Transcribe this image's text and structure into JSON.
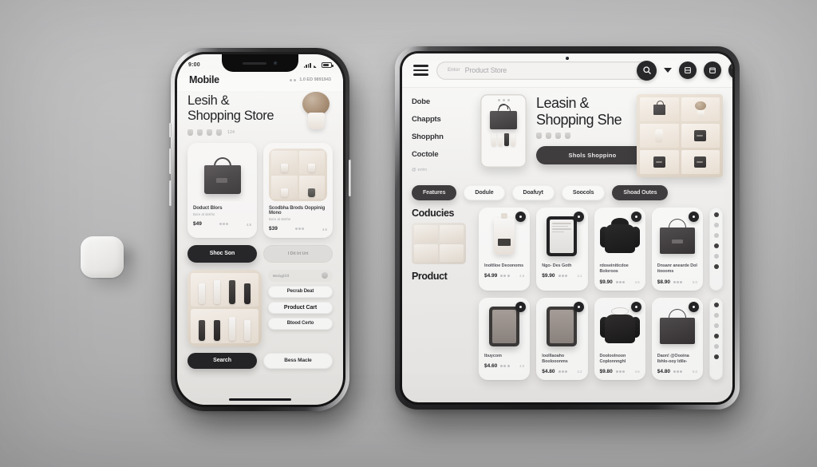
{
  "scene": {
    "background_color": "#bcbcbd",
    "objects": [
      {
        "name": "white-speaker-puck",
        "color": "#f5f3f0"
      }
    ]
  },
  "phone": {
    "frame_color": "#1d1d1f",
    "status_bar": {
      "time": "9:00",
      "icons": [
        "signal-icon",
        "wifi-icon",
        "battery-icon"
      ]
    },
    "app_bar": {
      "brand": "Mobile",
      "meta": "1.0 ED 9891943"
    },
    "hero": {
      "title_line1": "Lesih &",
      "title_line2": "Shopping Store",
      "sub_meta": "124",
      "decor": "potted-plant"
    },
    "cards": [
      {
        "name": "Doduct Blors",
        "desc": "Bore al skKhn",
        "price": "$49",
        "rating": "4.8",
        "image": "tote-bag"
      },
      {
        "name": "Scodbha Brods Ooppinig Mono",
        "desc": "Bore al skKhn",
        "price": "$39",
        "rating": "4.6",
        "image": "shelf-grid"
      }
    ],
    "pills": [
      {
        "label": "Shoc Son",
        "style": "dark"
      },
      {
        "label": "I Dit Irt Urt",
        "style": "ghost"
      }
    ],
    "lower": {
      "shelf_image": "bottle-shelf",
      "list_item": {
        "label": "Mobgliill",
        "toggle": true
      },
      "options": [
        {
          "label": "Pecrab Deat",
          "strong": false
        },
        {
          "label": "Product Cart",
          "strong": true
        },
        {
          "label": "Btood Certo",
          "strong": false
        }
      ]
    },
    "footer": [
      {
        "label": "Search",
        "style": "dark"
      },
      {
        "label": "Bess Macle",
        "style": "light"
      }
    ]
  },
  "tablet": {
    "frame_color": "#1c1c1d",
    "topbar": {
      "menu_icon": "hamburger-icon",
      "search": {
        "prefix": "Entor",
        "placeholder": "Product Store",
        "submit_icon": "search-icon"
      },
      "caret_icon": "caret-down-icon",
      "icons": [
        "grid-icon",
        "calendar-icon",
        "pause-icon"
      ]
    },
    "nav": {
      "items": [
        "Dobe",
        "Chappts",
        "Shopphn",
        "Coctole"
      ],
      "note": "@ entn"
    },
    "phone_card": {
      "image": "phone-mockup-with-bag"
    },
    "hero": {
      "title_line1": "Leasin &",
      "title_line2": "Shopping She",
      "cta": "Shols Shoppino"
    },
    "shelf": {
      "image": "six-cell-shelf"
    },
    "filters": [
      {
        "label": "Features",
        "style": "dark"
      },
      {
        "label": "Dodule",
        "style": "light"
      },
      {
        "label": "Doafuyt",
        "style": "light"
      },
      {
        "label": "Soocols",
        "style": "light"
      },
      {
        "label": "Shoad Outes",
        "style": "dark"
      }
    ],
    "sections": [
      {
        "title": "Coducies"
      },
      {
        "title": "Product"
      }
    ],
    "products_row1": [
      {
        "name": "Inoltlioe Deoonoms",
        "price": "$4.99",
        "meta": "4.6",
        "image": "cosmetic-bottle",
        "fav": true
      },
      {
        "name": "Ngo- Des Goth",
        "price": "$9.90",
        "meta": "4.1",
        "image": "e-reader",
        "fav": true
      },
      {
        "name": "rdoseiniticdoe Boloroos",
        "price": "$9.90",
        "meta": "4.5",
        "image": "black-hoodie",
        "fav": true
      },
      {
        "name": "Dnsanr anearde Dol itoooms",
        "price": "$8.90",
        "meta": "5.0",
        "image": "tote-bag",
        "fav": true
      }
    ],
    "products_row2": [
      {
        "name": "Ibuycom",
        "price": "$4.60",
        "meta": "4.0",
        "image": "tablet-grey",
        "fav": true
      },
      {
        "name": "Ioolllaoaho Boolooonms",
        "price": "$4.80",
        "meta": "4.2",
        "image": "tablet-brown",
        "fav": true
      },
      {
        "name": "Dooloolnoon Coplonnnghl",
        "price": "$9.80",
        "meta": "4.6",
        "image": "black-coat",
        "fav": true
      },
      {
        "name": "Daon! @Oooina Ibhlo-ooy ldile-",
        "price": "$4.80",
        "meta": "5.0",
        "image": "dark-tote",
        "fav": true
      }
    ],
    "rail_icons": [
      "gear-icon",
      "list-icon",
      "clock-icon",
      "send-icon",
      "tag-icon",
      "bag-icon"
    ]
  }
}
